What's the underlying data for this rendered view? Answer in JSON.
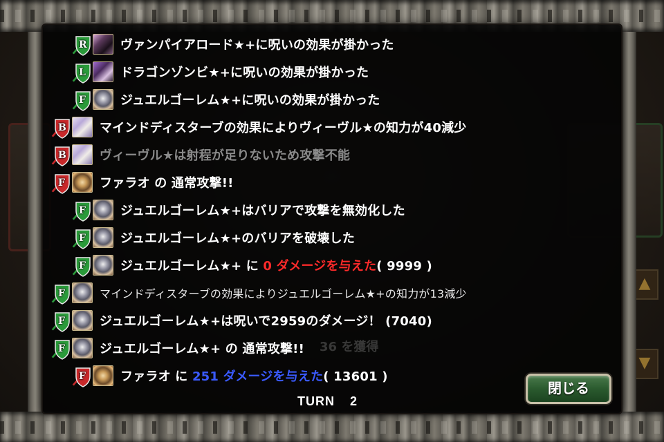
{
  "log_entries": [
    {
      "indent": 2,
      "unit": "R",
      "shield_color": "#2a9a3a",
      "portrait": "vampire",
      "parts": [
        {
          "text": "ヴァンパイアロード★+に呪いの効果が掛かった",
          "color": ""
        }
      ],
      "style": "bold"
    },
    {
      "indent": 2,
      "unit": "L",
      "shield_color": "#2a9a3a",
      "portrait": "dragon",
      "parts": [
        {
          "text": "ドラゴンゾンビ★+に呪いの効果が掛かった",
          "color": ""
        }
      ],
      "style": "bold"
    },
    {
      "indent": 2,
      "unit": "F",
      "shield_color": "#2a9a3a",
      "portrait": "golem",
      "parts": [
        {
          "text": "ジュエルゴーレム★+に呪いの効果が掛かった",
          "color": ""
        }
      ],
      "style": "bold"
    },
    {
      "indent": 0,
      "unit": "B",
      "shield_color": "#c8282a",
      "portrait": "veevel",
      "parts": [
        {
          "text": "マインドディスターブの効果によりヴィーヴル★の知力が40減少",
          "color": ""
        }
      ],
      "style": "bold"
    },
    {
      "indent": 0,
      "unit": "B",
      "shield_color": "#c8282a",
      "portrait": "veevel",
      "parts": [
        {
          "text": "ヴィーヴル★は射程が足りないため攻撃不能",
          "color": ""
        }
      ],
      "style": "dim"
    },
    {
      "indent": 0,
      "unit": "F",
      "shield_color": "#c8282a",
      "portrait": "pharaoh",
      "parts": [
        {
          "text": "ファラオ の 通常攻撃!!",
          "color": ""
        }
      ],
      "style": "bold"
    },
    {
      "indent": 2,
      "unit": "F",
      "shield_color": "#2a9a3a",
      "portrait": "golem",
      "parts": [
        {
          "text": "ジュエルゴーレム★+はバリアで攻撃を無効化した",
          "color": ""
        }
      ],
      "style": "bold"
    },
    {
      "indent": 2,
      "unit": "F",
      "shield_color": "#2a9a3a",
      "portrait": "golem",
      "parts": [
        {
          "text": "ジュエルゴーレム★+のバリアを破壊した",
          "color": ""
        }
      ],
      "style": "bold"
    },
    {
      "indent": 2,
      "unit": "F",
      "shield_color": "#2a9a3a",
      "portrait": "golem",
      "parts": [
        {
          "text": "ジュエルゴーレム★+ に ",
          "color": ""
        },
        {
          "text": "0 ダメージを与えた",
          "color": "red"
        },
        {
          "text": "( 9999 )",
          "color": ""
        }
      ],
      "style": "bold"
    },
    {
      "indent": 0,
      "unit": "F",
      "shield_color": "#2a9a3a",
      "portrait": "golem",
      "parts": [
        {
          "text": "マインドディスターブの効果によりジュエルゴーレム★+の知力が13減少",
          "color": ""
        }
      ],
      "style": "small"
    },
    {
      "indent": 0,
      "unit": "F",
      "shield_color": "#2a9a3a",
      "portrait": "golem",
      "parts": [
        {
          "text": "ジュエルゴーレム★+は呪いで2959のダメージ！ (7040)",
          "color": ""
        }
      ],
      "style": "bold"
    },
    {
      "indent": 0,
      "unit": "F",
      "shield_color": "#2a9a3a",
      "portrait": "golem",
      "parts": [
        {
          "text": "ジュエルゴーレム★+ の 通常攻撃!!",
          "color": ""
        }
      ],
      "style": "bold"
    },
    {
      "indent": 1,
      "unit": "F",
      "shield_color": "#c8282a",
      "portrait": "pharaoh",
      "parts": [
        {
          "text": "ファラオ に ",
          "color": ""
        },
        {
          "text": "251 ダメージを与えた",
          "color": "blue"
        },
        {
          "text": "( 13601 )",
          "color": ""
        }
      ],
      "style": "bold"
    }
  ],
  "turn": {
    "label": "TURN",
    "number": "2"
  },
  "close_button": {
    "label": "閉じる"
  },
  "background": {
    "ghost_text": "36 を獲得"
  }
}
